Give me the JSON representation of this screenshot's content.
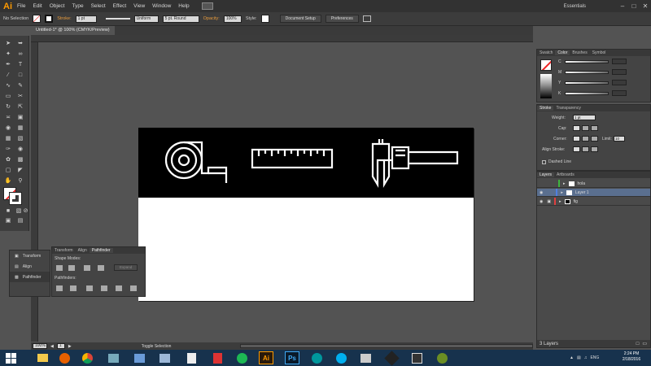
{
  "app": {
    "logo": "Ai",
    "workspace": "Essentials"
  },
  "menu": [
    "File",
    "Edit",
    "Object",
    "Type",
    "Select",
    "Effect",
    "View",
    "Window",
    "Help"
  ],
  "control_bar": {
    "selection_label": "No Selection",
    "stroke_label": "Stroke:",
    "stroke_weight": "1 pt",
    "stroke_profile": "Uniform",
    "brush": "5 pt. Round",
    "opacity_label": "Opacity:",
    "opacity_value": "100%",
    "style_label": "Style:",
    "document_setup": "Document Setup",
    "preferences": "Preferences"
  },
  "document_tab": "Untitled-1* @ 100% (CMYK/Preview)",
  "color_panel": {
    "tabs": [
      "Swatch",
      "Color",
      "Brushes",
      "Symbol"
    ],
    "channels": [
      {
        "label": "C"
      },
      {
        "label": "M"
      },
      {
        "label": "Y"
      },
      {
        "label": "K"
      }
    ]
  },
  "stroke_panel": {
    "tabs": [
      "Stroke",
      "Transparency"
    ],
    "weight_label": "Weight:",
    "weight_value": "1 pt",
    "cap_label": "Cap:",
    "corner_label": "Corner:",
    "limit_label": "Limit:",
    "limit_value": "10",
    "align_label": "Align Stroke:",
    "dashed_label": "Dashed Line"
  },
  "layers_panel": {
    "tabs": [
      "Layers",
      "Artboards"
    ],
    "layers": [
      {
        "name": "hola",
        "color": "#3fb53f"
      },
      {
        "name": "Layer 1",
        "color": "#4f7fe0"
      },
      {
        "name": "fig",
        "color": "#e04040"
      }
    ],
    "footer": "3 Layers"
  },
  "float_panel": {
    "dock_items": [
      "Transform",
      "Align",
      "Pathfinder"
    ],
    "tabs": [
      "Transform",
      "Align",
      "Pathfinder"
    ],
    "shape_modes_label": "Shape Modes:",
    "expand_label": "Expand",
    "pathfinders_label": "Pathfinders:"
  },
  "status_bar": {
    "zoom": "100%",
    "page": "1",
    "tool": "Toggle Selection"
  },
  "taskbar": {
    "apps": [
      "Ps",
      "Ai"
    ],
    "language": "ENG",
    "time": "2:24 PM",
    "date": "2/18/2016"
  },
  "colors": {
    "accent_orange": "#ff9a00",
    "taskbar": "#17324d",
    "selected_layer": "#5a6f8f"
  }
}
